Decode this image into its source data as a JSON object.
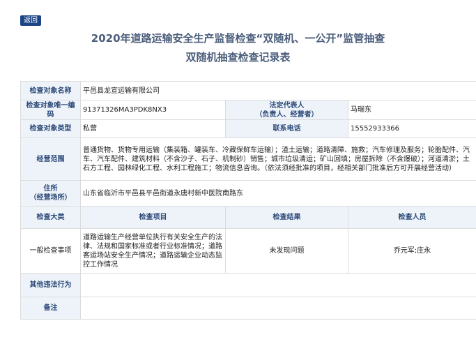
{
  "nav": {
    "back_label": "返回"
  },
  "header": {
    "title_line1": "2020年道路运输安全生产监督检查“双随机、一公开”监管抽查",
    "title_line2": "双随机抽查检查记录表"
  },
  "record": {
    "name_label": "检查对象名称",
    "name_value": "平邑县龙宣运输有限公司",
    "code_label": "检查对象唯一编码",
    "code_value": "91371326MA3PDK8NX3",
    "rep_label_line1": "法定代表人",
    "rep_label_line2": "（负责人、经营者）",
    "rep_value": "马瑞东",
    "type_label": "检查对象类型",
    "type_value": "私营",
    "phone_label": "联系电话",
    "phone_value": "15552933366",
    "scope_label": "经营范围",
    "scope_value": "普通货物、货物专用运输（集装箱、罐装车、冷藏保鲜车运输）；渣土运输；道路清障、施救；汽车修理及服务；轮胎配件、汽车、汽车配件、建筑材料（不含沙子、石子、机制砂）销售；城市垃圾清运；矿山回填；房屋拆除（不含爆破）；河道清淤；土石方工程、园林绿化工程、水利工程施工；物流信息咨询。（依法须经批准的项目，经相关部门批准后方可开展经营活动）",
    "address_label_line1": "住所",
    "address_label_line2": "（经营场所）",
    "address_value": "山东省临沂市平邑县平邑街道永唐村新中医院南路东"
  },
  "inspection": {
    "headers": [
      "检查大类",
      "检查项目",
      "检查结果",
      "检查人员"
    ],
    "row": {
      "category": "一般检查事项",
      "item": "道路运输生产经营单位执行有关安全生产的法律、法规和国家标准或者行业标准情况；道路客运场站安全生产情况；道路运输企业动态监控工作情况",
      "result": "未发现问题",
      "inspectors": "乔元军;庄永"
    },
    "other_label": "其他违法行为",
    "other_value": "",
    "remark_label": "备注",
    "remark_value": ""
  }
}
